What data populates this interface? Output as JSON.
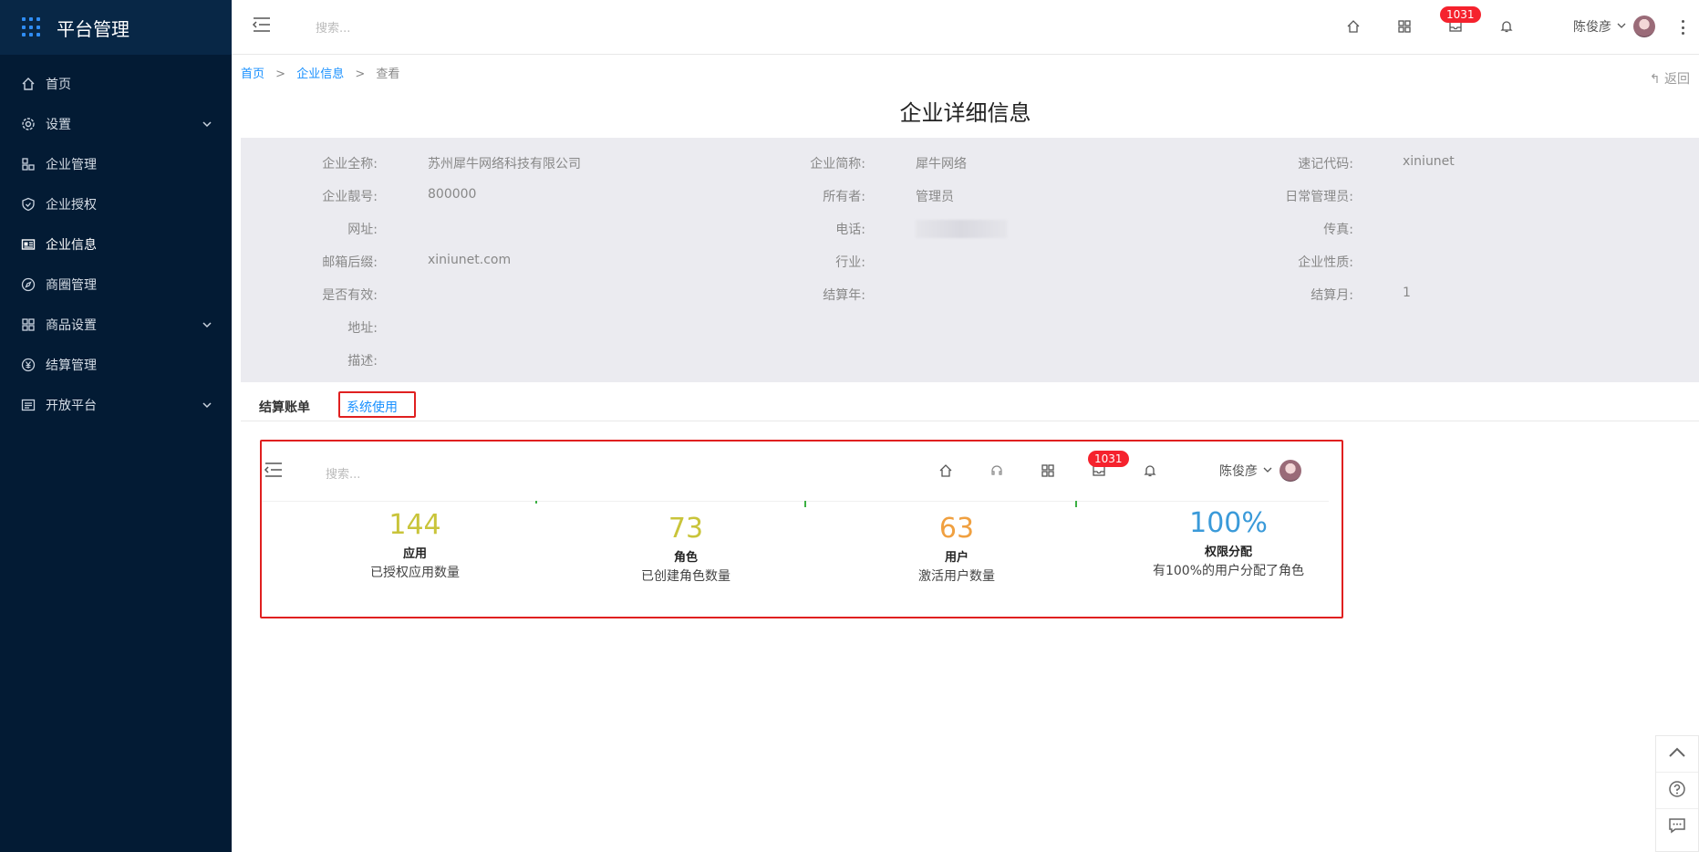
{
  "sidebar": {
    "app_title": "平台管理",
    "items": [
      {
        "label": "首页",
        "icon": "home-icon",
        "active": false,
        "has_children": false
      },
      {
        "label": "设置",
        "icon": "gear-icon",
        "active": false,
        "has_children": true
      },
      {
        "label": "企业管理",
        "icon": "org-icon",
        "active": false,
        "has_children": false
      },
      {
        "label": "企业授权",
        "icon": "shield-icon",
        "active": false,
        "has_children": false
      },
      {
        "label": "企业信息",
        "icon": "id-card-icon",
        "active": true,
        "has_children": false
      },
      {
        "label": "商圈管理",
        "icon": "compass-icon",
        "active": false,
        "has_children": false
      },
      {
        "label": "商品设置",
        "icon": "grid-icon",
        "active": false,
        "has_children": true
      },
      {
        "label": "结算管理",
        "icon": "yen-icon",
        "active": false,
        "has_children": false
      },
      {
        "label": "开放平台",
        "icon": "list-icon",
        "active": false,
        "has_children": true
      }
    ]
  },
  "header": {
    "search_placeholder": "搜索...",
    "badge_count": "1031",
    "user_name": "陈俊彦"
  },
  "breadcrumb": {
    "home": "首页",
    "parent": "企业信息",
    "current": "查看",
    "separator": ">"
  },
  "back_label": "返回",
  "page_title": "企业详细信息",
  "info": {
    "full_name_label": "企业全称:",
    "full_name": "苏州犀牛网络科技有限公司",
    "short_name_label": "企业简称:",
    "short_name": "犀牛网络",
    "code_label": "速记代码:",
    "code": "xiniunet",
    "account_label": "企业靓号:",
    "account": "800000",
    "owner_label": "所有者:",
    "owner": "管理员",
    "daily_admin_label": "日常管理员:",
    "daily_admin": "",
    "website_label": "网址:",
    "website": "",
    "phone_label": "电话:",
    "fax_label": "传真:",
    "fax": "",
    "email_suffix_label": "邮箱后缀:",
    "email_suffix": "xiniunet.com",
    "industry_label": "行业:",
    "industry": "",
    "nature_label": "企业性质:",
    "nature": "",
    "valid_label": "是否有效:",
    "valid": "",
    "settle_year_label": "结算年:",
    "settle_year": "",
    "settle_month_label": "结算月:",
    "settle_month": "1",
    "address_label": "地址:",
    "address": "",
    "desc_label": "描述:",
    "desc": ""
  },
  "tabs": [
    {
      "label": "结算账单",
      "active": false
    },
    {
      "label": "系统使用",
      "active": true
    }
  ],
  "embedded": {
    "search_placeholder": "搜索...",
    "badge_count": "1031",
    "user_name": "陈俊彦",
    "stats": [
      {
        "value": "144",
        "name": "应用",
        "desc": "已授权应用数量",
        "color": "#c9c43a"
      },
      {
        "value": "73",
        "name": "角色",
        "desc": "已创建角色数量",
        "color": "#c9c43a"
      },
      {
        "value": "63",
        "name": "用户",
        "desc": "激活用户数量",
        "color": "#f0a040"
      },
      {
        "value": "100%",
        "name": "权限分配",
        "desc": "有100%的用户分配了角色",
        "color": "#3a9ad9"
      }
    ]
  },
  "colors": {
    "sidebar_bg": "#031b34",
    "accent": "#1890ff",
    "highlight_border": "#e02020",
    "badge": "#f5222d"
  }
}
